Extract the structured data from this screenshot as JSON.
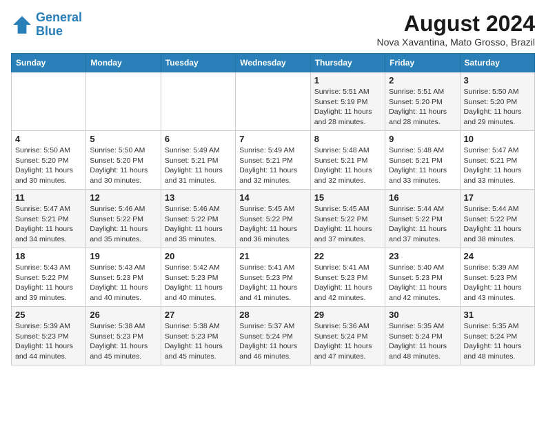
{
  "header": {
    "logo_line1": "General",
    "logo_line2": "Blue",
    "month_year": "August 2024",
    "location": "Nova Xavantina, Mato Grosso, Brazil"
  },
  "days_of_week": [
    "Sunday",
    "Monday",
    "Tuesday",
    "Wednesday",
    "Thursday",
    "Friday",
    "Saturday"
  ],
  "weeks": [
    [
      {
        "day": "",
        "info": ""
      },
      {
        "day": "",
        "info": ""
      },
      {
        "day": "",
        "info": ""
      },
      {
        "day": "",
        "info": ""
      },
      {
        "day": "1",
        "info": "Sunrise: 5:51 AM\nSunset: 5:19 PM\nDaylight: 11 hours and 28 minutes."
      },
      {
        "day": "2",
        "info": "Sunrise: 5:51 AM\nSunset: 5:20 PM\nDaylight: 11 hours and 28 minutes."
      },
      {
        "day": "3",
        "info": "Sunrise: 5:50 AM\nSunset: 5:20 PM\nDaylight: 11 hours and 29 minutes."
      }
    ],
    [
      {
        "day": "4",
        "info": "Sunrise: 5:50 AM\nSunset: 5:20 PM\nDaylight: 11 hours and 30 minutes."
      },
      {
        "day": "5",
        "info": "Sunrise: 5:50 AM\nSunset: 5:20 PM\nDaylight: 11 hours and 30 minutes."
      },
      {
        "day": "6",
        "info": "Sunrise: 5:49 AM\nSunset: 5:21 PM\nDaylight: 11 hours and 31 minutes."
      },
      {
        "day": "7",
        "info": "Sunrise: 5:49 AM\nSunset: 5:21 PM\nDaylight: 11 hours and 32 minutes."
      },
      {
        "day": "8",
        "info": "Sunrise: 5:48 AM\nSunset: 5:21 PM\nDaylight: 11 hours and 32 minutes."
      },
      {
        "day": "9",
        "info": "Sunrise: 5:48 AM\nSunset: 5:21 PM\nDaylight: 11 hours and 33 minutes."
      },
      {
        "day": "10",
        "info": "Sunrise: 5:47 AM\nSunset: 5:21 PM\nDaylight: 11 hours and 33 minutes."
      }
    ],
    [
      {
        "day": "11",
        "info": "Sunrise: 5:47 AM\nSunset: 5:21 PM\nDaylight: 11 hours and 34 minutes."
      },
      {
        "day": "12",
        "info": "Sunrise: 5:46 AM\nSunset: 5:22 PM\nDaylight: 11 hours and 35 minutes."
      },
      {
        "day": "13",
        "info": "Sunrise: 5:46 AM\nSunset: 5:22 PM\nDaylight: 11 hours and 35 minutes."
      },
      {
        "day": "14",
        "info": "Sunrise: 5:45 AM\nSunset: 5:22 PM\nDaylight: 11 hours and 36 minutes."
      },
      {
        "day": "15",
        "info": "Sunrise: 5:45 AM\nSunset: 5:22 PM\nDaylight: 11 hours and 37 minutes."
      },
      {
        "day": "16",
        "info": "Sunrise: 5:44 AM\nSunset: 5:22 PM\nDaylight: 11 hours and 37 minutes."
      },
      {
        "day": "17",
        "info": "Sunrise: 5:44 AM\nSunset: 5:22 PM\nDaylight: 11 hours and 38 minutes."
      }
    ],
    [
      {
        "day": "18",
        "info": "Sunrise: 5:43 AM\nSunset: 5:22 PM\nDaylight: 11 hours and 39 minutes."
      },
      {
        "day": "19",
        "info": "Sunrise: 5:43 AM\nSunset: 5:23 PM\nDaylight: 11 hours and 40 minutes."
      },
      {
        "day": "20",
        "info": "Sunrise: 5:42 AM\nSunset: 5:23 PM\nDaylight: 11 hours and 40 minutes."
      },
      {
        "day": "21",
        "info": "Sunrise: 5:41 AM\nSunset: 5:23 PM\nDaylight: 11 hours and 41 minutes."
      },
      {
        "day": "22",
        "info": "Sunrise: 5:41 AM\nSunset: 5:23 PM\nDaylight: 11 hours and 42 minutes."
      },
      {
        "day": "23",
        "info": "Sunrise: 5:40 AM\nSunset: 5:23 PM\nDaylight: 11 hours and 42 minutes."
      },
      {
        "day": "24",
        "info": "Sunrise: 5:39 AM\nSunset: 5:23 PM\nDaylight: 11 hours and 43 minutes."
      }
    ],
    [
      {
        "day": "25",
        "info": "Sunrise: 5:39 AM\nSunset: 5:23 PM\nDaylight: 11 hours and 44 minutes."
      },
      {
        "day": "26",
        "info": "Sunrise: 5:38 AM\nSunset: 5:23 PM\nDaylight: 11 hours and 45 minutes."
      },
      {
        "day": "27",
        "info": "Sunrise: 5:38 AM\nSunset: 5:23 PM\nDaylight: 11 hours and 45 minutes."
      },
      {
        "day": "28",
        "info": "Sunrise: 5:37 AM\nSunset: 5:24 PM\nDaylight: 11 hours and 46 minutes."
      },
      {
        "day": "29",
        "info": "Sunrise: 5:36 AM\nSunset: 5:24 PM\nDaylight: 11 hours and 47 minutes."
      },
      {
        "day": "30",
        "info": "Sunrise: 5:35 AM\nSunset: 5:24 PM\nDaylight: 11 hours and 48 minutes."
      },
      {
        "day": "31",
        "info": "Sunrise: 5:35 AM\nSunset: 5:24 PM\nDaylight: 11 hours and 48 minutes."
      }
    ]
  ]
}
